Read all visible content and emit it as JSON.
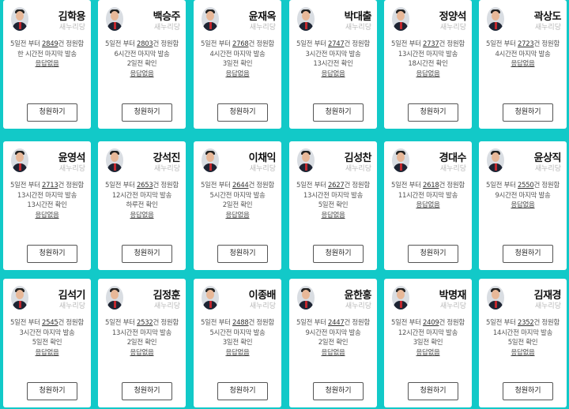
{
  "cards": [
    {
      "name": "김학용",
      "party": "새누리당",
      "pre": "5일전 부터",
      "count": "2849",
      "unit": "건 정원함",
      "lines": [
        "한 시간전 마지막 발송"
      ],
      "reply": "응답없음",
      "button": "청원하기"
    },
    {
      "name": "백승주",
      "party": "새누리당",
      "pre": "5일전 부터",
      "count": "2803",
      "unit": "건 정원함",
      "lines": [
        "6시간전 마지막 발송",
        "2일전 확인"
      ],
      "reply": "응답없음",
      "button": "청원하기"
    },
    {
      "name": "윤재옥",
      "party": "새누리당",
      "pre": "5일전 부터",
      "count": "2768",
      "unit": "건 정원함",
      "lines": [
        "4시간전 마지막 발송",
        "3일전 확인"
      ],
      "reply": "응답없음",
      "button": "청원하기"
    },
    {
      "name": "박대출",
      "party": "새누리당",
      "pre": "5일전 부터",
      "count": "2747",
      "unit": "건 정원함",
      "lines": [
        "3시간전 마지막 발송",
        "13시간전 확인"
      ],
      "reply": "응답없음",
      "button": "청원하기"
    },
    {
      "name": "정양석",
      "party": "새누리당",
      "pre": "5일전 부터",
      "count": "2737",
      "unit": "건 정원함",
      "lines": [
        "13시간전 마지막 발송",
        "18시간전 확인"
      ],
      "reply": "응답없음",
      "button": "청원하기"
    },
    {
      "name": "곽상도",
      "party": "새누리당",
      "pre": "5일전 부터",
      "count": "2723",
      "unit": "건 정원함",
      "lines": [
        "4시간전 마지막 발송"
      ],
      "reply": "응답없음",
      "button": "청원하기"
    },
    {
      "name": "윤영석",
      "party": "새누리당",
      "pre": "5일전 부터",
      "count": "2713",
      "unit": "건 정원함",
      "lines": [
        "13시간전 마지막 발송",
        "13시간전 확인"
      ],
      "reply": "응답없음",
      "button": "청원하기"
    },
    {
      "name": "강석진",
      "party": "새누리당",
      "pre": "5일전 부터",
      "count": "2653",
      "unit": "건 정원함",
      "lines": [
        "12시간전 마지막 발송",
        "하루전 확인"
      ],
      "reply": "응답없음",
      "button": "청원하기"
    },
    {
      "name": "이채익",
      "party": "새누리당",
      "pre": "5일전 부터",
      "count": "2644",
      "unit": "건 정원함",
      "lines": [
        "5시간전 마지막 발송",
        "2일전 확인"
      ],
      "reply": "응답없음",
      "button": "청원하기"
    },
    {
      "name": "김성찬",
      "party": "새누리당",
      "pre": "5일전 부터",
      "count": "2627",
      "unit": "건 정원함",
      "lines": [
        "13시간전 마지막 발송",
        "5일전 확인"
      ],
      "reply": "응답없음",
      "button": "청원하기"
    },
    {
      "name": "경대수",
      "party": "새누리당",
      "pre": "5일전 부터",
      "count": "2618",
      "unit": "건 정원함",
      "lines": [
        "11시간전 마지막 발송"
      ],
      "reply": "응답없음",
      "button": "청원하기"
    },
    {
      "name": "윤상직",
      "party": "새누리당",
      "pre": "5일전 부터",
      "count": "2550",
      "unit": "건 정원함",
      "lines": [
        "9시간전 마지막 발송"
      ],
      "reply": "응답없음",
      "button": "청원하기"
    },
    {
      "name": "김석기",
      "party": "새누리당",
      "pre": "5일전 부터",
      "count": "2545",
      "unit": "건 정원함",
      "lines": [
        "3시간전 마지막 발송",
        "5일전 확인"
      ],
      "reply": "응답없음",
      "button": "청원하기"
    },
    {
      "name": "김정훈",
      "party": "새누리당",
      "pre": "5일전 부터",
      "count": "2532",
      "unit": "건 정원함",
      "lines": [
        "13시간전 마지막 발송",
        "2일전 확인"
      ],
      "reply": "응답없음",
      "button": "청원하기"
    },
    {
      "name": "이종배",
      "party": "새누리당",
      "pre": "5일전 부터",
      "count": "2488",
      "unit": "건 정원함",
      "lines": [
        "5시간전 마지막 발송",
        "3일전 확인"
      ],
      "reply": "응답없음",
      "button": "청원하기"
    },
    {
      "name": "윤한홍",
      "party": "새누리당",
      "pre": "5일전 부터",
      "count": "2447",
      "unit": "건 정원함",
      "lines": [
        "9시간전 마지막 발송",
        "2일전 확인"
      ],
      "reply": "응답없음",
      "button": "청원하기"
    },
    {
      "name": "박명재",
      "party": "새누리당",
      "pre": "5일전 부터",
      "count": "2409",
      "unit": "건 정원함",
      "lines": [
        "12시간전 마지막 발송",
        "3일전 확인"
      ],
      "reply": "응답없음",
      "button": "청원하기"
    },
    {
      "name": "김재경",
      "party": "새누리당",
      "pre": "5일전 부터",
      "count": "2352",
      "unit": "건 정원함",
      "lines": [
        "14시간전 마지막 발송",
        "5일전 확인"
      ],
      "reply": "응답없음",
      "button": "청원하기"
    }
  ]
}
